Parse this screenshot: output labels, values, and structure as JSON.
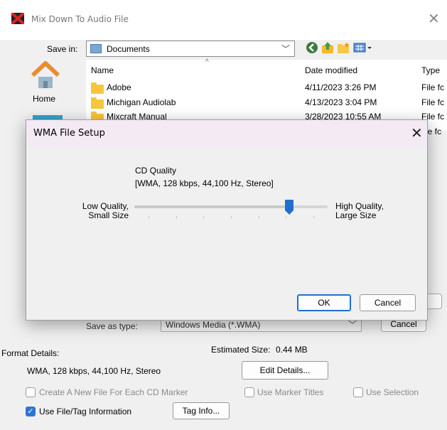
{
  "window": {
    "title": "Mix Down To Audio File",
    "close": "✕"
  },
  "save_in": {
    "label": "Save in:",
    "value": "Documents"
  },
  "places": {
    "home": "Home"
  },
  "file_list": {
    "columns": [
      "Name",
      "Date modified",
      "Type"
    ],
    "rows": [
      {
        "name": "Adobe",
        "date": "4/11/2023 3:26 PM",
        "type": "File fc"
      },
      {
        "name": "Michigan Audiolab",
        "date": "4/13/2023 3:04 PM",
        "type": "File fc"
      },
      {
        "name": "Mixcraft Manual",
        "date": "3/28/2023 10:55 AM",
        "type": "File fc"
      }
    ],
    "partial_type": "le fc"
  },
  "save_as_type": {
    "label": "Save as type:",
    "value": "Windows Media (*.WMA)"
  },
  "outer_cancel": "Cancel",
  "format_details": {
    "label": "Format Details:",
    "estimated_size_label": "Estimated Size:",
    "estimated_size_value": "0.44 MB",
    "value": "WMA, 128 kbps, 44,100 Hz, Stereo",
    "edit_button": "Edit Details..."
  },
  "options": {
    "new_file_per_marker": {
      "label": "Create A New File For Each CD Marker",
      "checked": false
    },
    "use_marker_titles": {
      "label": "Use Marker Titles",
      "checked": false
    },
    "use_selection": {
      "label": "Use Selection",
      "checked": false
    },
    "use_file_tag_info": {
      "label": "Use File/Tag Information",
      "checked": true
    },
    "tag_info_button": "Tag Info..."
  },
  "wma_dialog": {
    "title": "WMA File Setup",
    "close": "✕",
    "quality_title": "CD Quality",
    "quality_desc": "[WMA, 128 kbps, 44,100 Hz, Stereo]",
    "low_label_1": "Low Quality,",
    "low_label_2": "Small Size",
    "high_label_1": "High Quality,",
    "high_label_2": "Large Size",
    "slider_level": 0.8,
    "slider_ticks": 7,
    "ok": "OK",
    "cancel": "Cancel"
  },
  "colors": {
    "accent": "#1f6fd1",
    "checkbox": "#2f74d1",
    "folder": "#f8c63a"
  }
}
